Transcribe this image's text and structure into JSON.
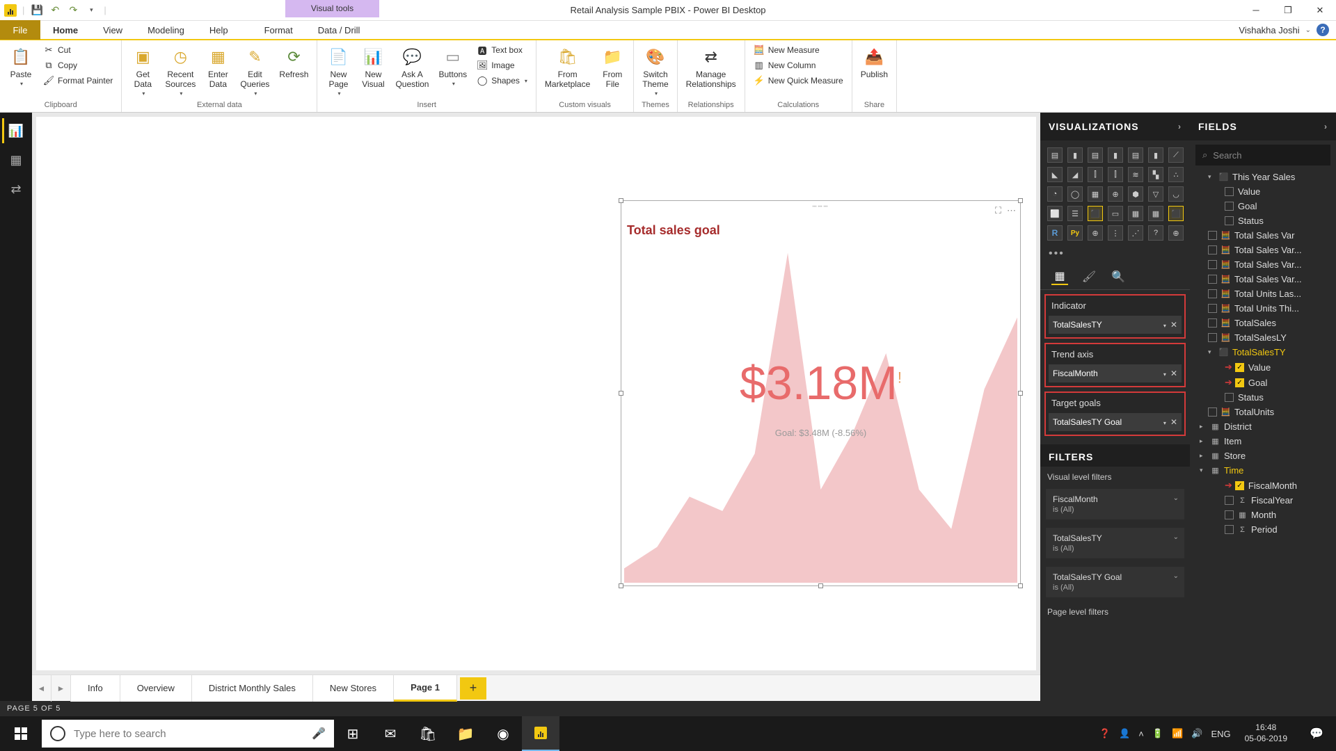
{
  "app_title": "Retail Analysis Sample PBIX - Power BI Desktop",
  "visual_tools_label": "Visual tools",
  "user_name": "Vishakha Joshi",
  "menu": {
    "file": "File",
    "home": "Home",
    "view": "View",
    "modeling": "Modeling",
    "help": "Help",
    "format": "Format",
    "datadrill": "Data / Drill"
  },
  "ribbon": {
    "paste": "Paste",
    "cut": "Cut",
    "copy": "Copy",
    "format_painter": "Format Painter",
    "get_data": "Get\nData",
    "recent_sources": "Recent\nSources",
    "enter_data": "Enter\nData",
    "edit_queries": "Edit\nQueries",
    "refresh": "Refresh",
    "new_page": "New\nPage",
    "new_visual": "New\nVisual",
    "ask_question": "Ask A\nQuestion",
    "buttons": "Buttons",
    "text_box": "Text box",
    "image": "Image",
    "shapes": "Shapes",
    "from_marketplace": "From\nMarketplace",
    "from_file": "From\nFile",
    "switch_theme": "Switch\nTheme",
    "manage_rel": "Manage\nRelationships",
    "new_measure": "New Measure",
    "new_column": "New Column",
    "new_quick_measure": "New Quick Measure",
    "publish": "Publish",
    "g_clipboard": "Clipboard",
    "g_external": "External data",
    "g_insert": "Insert",
    "g_custom": "Custom visuals",
    "g_themes": "Themes",
    "g_rel": "Relationships",
    "g_calc": "Calculations",
    "g_share": "Share"
  },
  "visualization_pane_title": "VISUALIZATIONS",
  "fields_pane_title": "FIELDS",
  "search_placeholder": "Search",
  "wells": {
    "indicator_label": "Indicator",
    "indicator_value": "TotalSalesTY",
    "trend_label": "Trend axis",
    "trend_value": "FiscalMonth",
    "target_label": "Target goals",
    "target_value": "TotalSalesTY Goal"
  },
  "filters_title": "FILTERS",
  "filters": {
    "visual_section": "Visual level filters",
    "f1": "FiscalMonth",
    "f1s": "is (All)",
    "f2": "TotalSalesTY",
    "f2s": "is (All)",
    "f3": "TotalSalesTY Goal",
    "f3s": "is (All)",
    "page_section": "Page level filters"
  },
  "fields_tree": {
    "tys": "This Year Sales",
    "value": "Value",
    "goal": "Goal",
    "status": "Status",
    "tsv": "Total Sales Var",
    "tsv1": "Total Sales Var...",
    "tsv2": "Total Sales Var...",
    "tsv3": "Total Sales Var...",
    "tul": "Total Units Las...",
    "tut": "Total Units Thi...",
    "ts": "TotalSales",
    "tsly": "TotalSalesLY",
    "tsty": "TotalSalesTY",
    "tsty_value": "Value",
    "tsty_goal": "Goal",
    "tsty_status": "Status",
    "tu": "TotalUnits",
    "district": "District",
    "item": "Item",
    "store": "Store",
    "time": "Time",
    "fm": "FiscalMonth",
    "fy": "FiscalYear",
    "month": "Month",
    "period": "Period"
  },
  "visual": {
    "title": "Total sales goal",
    "value": "$3.18M",
    "goal_text": "Goal: $3.48M (-8.56%)"
  },
  "chart_data": {
    "type": "area",
    "title": "Total sales goal",
    "x_field": "FiscalMonth",
    "indicator_field": "TotalSalesTY",
    "target_field": "TotalSalesTY Goal",
    "kpi_value": 3180000,
    "kpi_value_display": "$3.18M",
    "goal_value": 3480000,
    "goal_display": "$3.48M",
    "variance_pct": -8.56,
    "status": "bad",
    "trend_values": [
      0.05,
      0.15,
      0.35,
      0.3,
      0.5,
      0.98,
      0.38,
      0.55,
      0.78,
      0.32,
      0.18,
      0.62
    ]
  },
  "page_tabs": {
    "info": "Info",
    "overview": "Overview",
    "dms": "District Monthly Sales",
    "ns": "New Stores",
    "p1": "Page 1"
  },
  "status": "PAGE 5 OF 5",
  "taskbar": {
    "search_placeholder": "Type here to search",
    "lang": "ENG",
    "time": "16:48",
    "date": "05-06-2019"
  }
}
